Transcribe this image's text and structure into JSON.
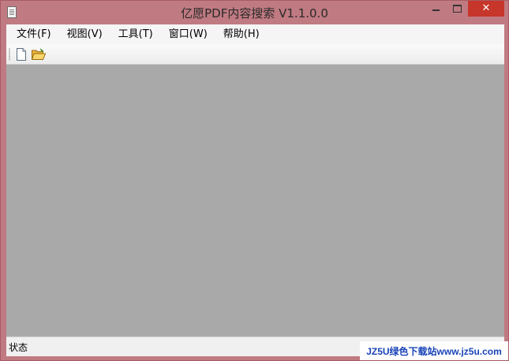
{
  "window": {
    "title": "亿愿PDF内容搜索 V1.1.0.0",
    "controls": {
      "minimize_icon": "minimize-icon",
      "maximize_icon": "maximize-icon",
      "close_icon": "close-icon",
      "close_glyph": "✕"
    },
    "colors": {
      "frame": "#c07a82",
      "close_button": "#c7362a",
      "workspace": "#a9a9a9"
    }
  },
  "menubar": {
    "items": [
      {
        "label": "文件(F)"
      },
      {
        "label": "视图(V)"
      },
      {
        "label": "工具(T)"
      },
      {
        "label": "窗口(W)"
      },
      {
        "label": "帮助(H)"
      }
    ]
  },
  "toolbar": {
    "buttons": [
      {
        "icon": "new-file-icon"
      },
      {
        "icon": "open-folder-icon"
      }
    ]
  },
  "statusbar": {
    "text": "状态"
  },
  "watermark": {
    "text": "JZ5U绿色下载站www.jz5u.com"
  }
}
